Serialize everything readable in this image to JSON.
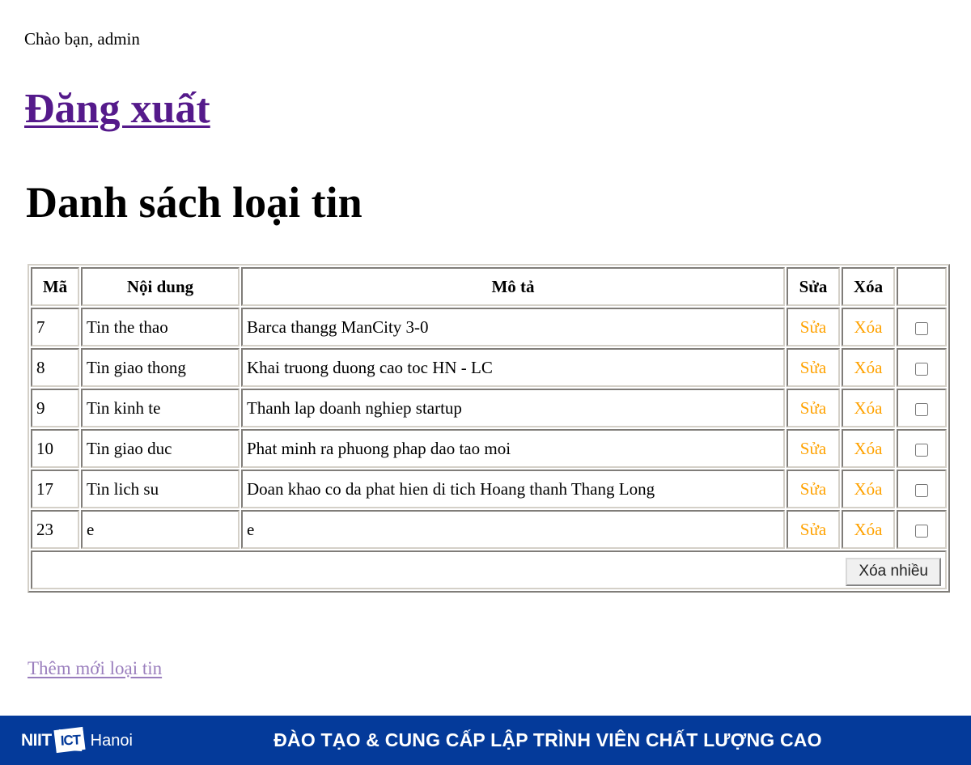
{
  "greeting": "Chào bạn, admin",
  "logout_link": "Đăng xuất",
  "page_title": "Danh sách loại tin",
  "table": {
    "headers": {
      "id": "Mã",
      "name": "Nội dung",
      "description": "Mô tả",
      "edit": "Sửa",
      "delete": "Xóa",
      "select": ""
    },
    "rows": [
      {
        "id": "7",
        "name": "Tin the thao",
        "description": "Barca thangg ManCity 3-0",
        "edit": "Sửa",
        "delete": "Xóa",
        "checked": false
      },
      {
        "id": "8",
        "name": "Tin giao thong",
        "description": "Khai truong duong cao toc HN - LC",
        "edit": "Sửa",
        "delete": "Xóa",
        "checked": false
      },
      {
        "id": "9",
        "name": "Tin kinh te",
        "description": "Thanh lap doanh nghiep startup",
        "edit": "Sửa",
        "delete": "Xóa",
        "checked": false
      },
      {
        "id": "10",
        "name": "Tin giao duc",
        "description": "Phat minh ra phuong phap dao tao moi",
        "edit": "Sửa",
        "delete": "Xóa",
        "checked": false
      },
      {
        "id": "17",
        "name": "Tin lich su",
        "description": "Doan khao co da phat hien di tich Hoang thanh Thang Long",
        "edit": "Sửa",
        "delete": "Xóa",
        "checked": false
      },
      {
        "id": "23",
        "name": "e",
        "description": "e",
        "edit": "Sửa",
        "delete": "Xóa",
        "checked": false
      }
    ],
    "bulk_delete_label": "Xóa nhiều"
  },
  "add_new_link": "Thêm mới loại tin",
  "footer": {
    "logo_primary": "NIIT",
    "logo_badge": "ICT",
    "logo_suffix": "Hanoi",
    "tagline": "ĐÀO TẠO & CUNG CẤP LẬP TRÌNH VIÊN CHẤT LƯỢNG CAO"
  },
  "colors": {
    "action_link": "#ffa200",
    "logout_link": "#551a8b",
    "add_link": "#9a7ebd",
    "footer_bg": "#043a9a",
    "text": "#000000"
  }
}
